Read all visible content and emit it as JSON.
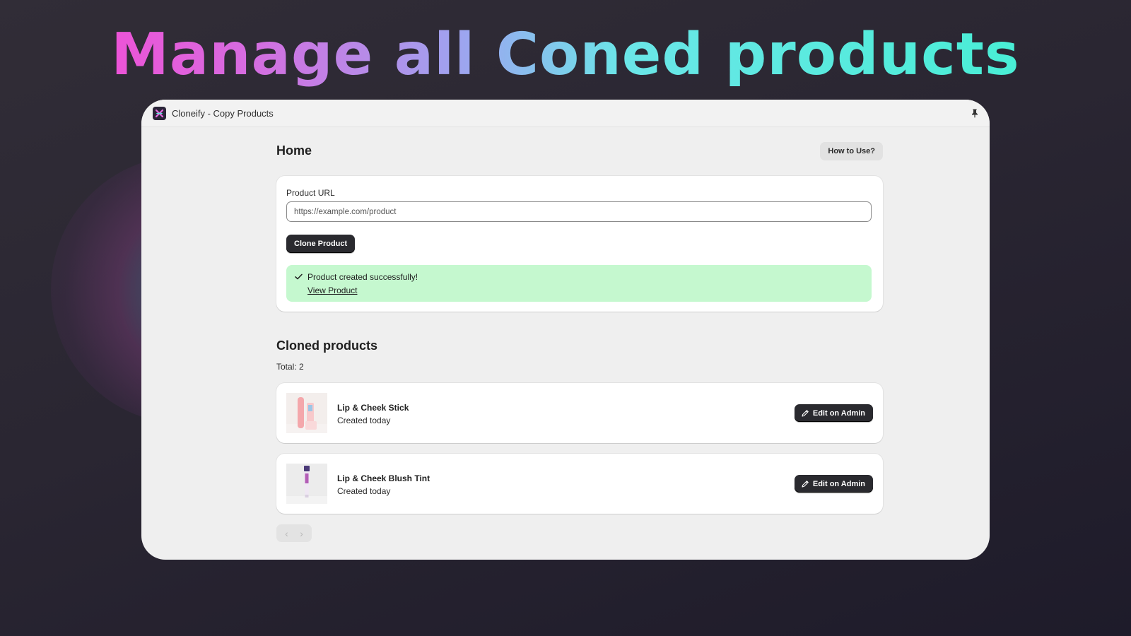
{
  "headline": "Manage all Coned products",
  "app": {
    "title": "Cloneify - Copy Products",
    "logo_icon": "cloneify-logo-icon",
    "pin_icon": "pin-icon"
  },
  "page": {
    "title": "Home",
    "help_button": "How to Use?"
  },
  "form": {
    "label": "Product URL",
    "placeholder": "https://example.com/product",
    "submit_label": "Clone Product",
    "banner": {
      "message": "Product created successfully!",
      "link": "View Product",
      "color": "#c5f8cf"
    }
  },
  "cloned": {
    "title": "Cloned products",
    "total": "Total: 2",
    "items": [
      {
        "name": "Lip & Cheek Stick",
        "meta": "Created today",
        "action": "Edit on Admin"
      },
      {
        "name": "Lip & Cheek Blush Tint",
        "meta": "Created today",
        "action": "Edit on Admin"
      }
    ]
  },
  "pagination": {
    "prev_icon": "chevron-left-icon",
    "next_icon": "chevron-right-icon",
    "prev": "‹",
    "next": "›"
  },
  "colors": {
    "primary_button": "#2a2a2f",
    "success_bg": "#c5f8cf",
    "headline_gradient": [
      "#ff3fd0",
      "#9aa8f0",
      "#3ff0d0"
    ]
  }
}
